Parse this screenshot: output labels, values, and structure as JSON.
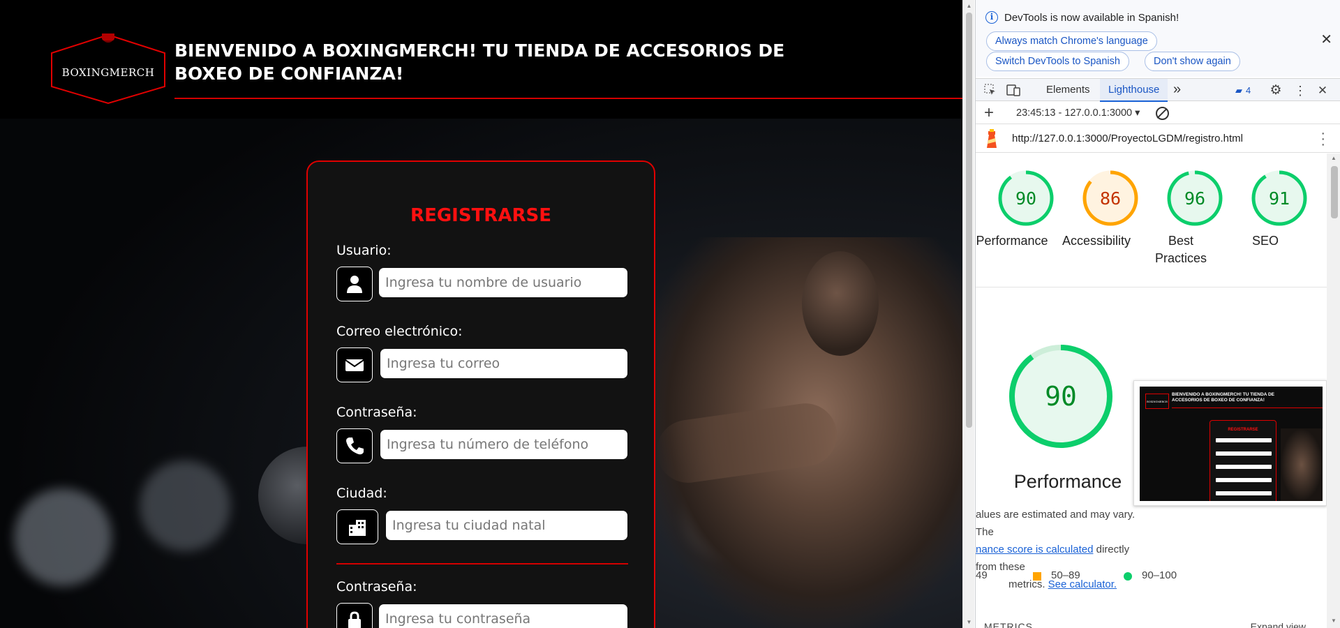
{
  "site": {
    "logo_text": "BOXINGMERCH",
    "title": "BIENVENIDO A BOXINGMERCH! TU TIENDA DE ACCESORIOS DE BOXEO DE CONFIANZA!",
    "form": {
      "heading": "REGISTRARSE",
      "fields": [
        {
          "label": "Usuario:",
          "placeholder": "Ingresa tu nombre de usuario",
          "value": "",
          "icon": "user-icon"
        },
        {
          "label": "Correo electrónico:",
          "placeholder": "Ingresa tu correo",
          "value": "",
          "icon": "envelope-icon"
        },
        {
          "label": "Contraseña:",
          "placeholder": "Ingresa tu número de teléfono",
          "value": "",
          "icon": "phone-icon"
        },
        {
          "label": "Ciudad:",
          "placeholder": "Ingresa tu ciudad natal",
          "value": "",
          "icon": "city-icon"
        },
        {
          "label": "Contraseña:",
          "placeholder": "Ingresa tu contraseña",
          "value": "",
          "icon": "lock-icon"
        }
      ]
    }
  },
  "devtools": {
    "infobar": {
      "message": "DevTools is now available in Spanish!",
      "btn_match": "Always match Chrome's language",
      "btn_switch": "Switch DevTools to Spanish",
      "btn_dont_show": "Don't show again"
    },
    "tabs": {
      "elements": "Elements",
      "lighthouse": "Lighthouse",
      "more": "»",
      "issues_count": "4"
    },
    "session": "23:45:13 - 127.0.0.1:3000 ▾",
    "url": "http://127.0.0.1:3000/ProyectoLGDM/registro.html",
    "scores": [
      {
        "label": "Performance",
        "value": "90",
        "score": 0.9,
        "color": "#0cce6b",
        "bg": "#e7f8ee",
        "text_color": "#008a26"
      },
      {
        "label": "Accessibility",
        "value": "86",
        "score": 0.86,
        "color": "#ffa400",
        "bg": "#fff3e0",
        "text_color": "#c33300"
      },
      {
        "label": "Best Practices",
        "value": "96",
        "score": 0.96,
        "color": "#0cce6b",
        "bg": "#e7f8ee",
        "text_color": "#008a26"
      },
      {
        "label": "SEO",
        "value": "91",
        "score": 0.91,
        "color": "#0cce6b",
        "bg": "#e7f8ee",
        "text_color": "#008a26"
      }
    ],
    "main_score": {
      "label": "Performance",
      "value": "90",
      "score": 0.9
    },
    "thumbnail": {
      "title": "BIENVENIDO A BOXINGMERCH! TU TIENDA DE ACCESORIOS DE BOXEO DE CONFIANZA!",
      "logo": "BOXINGMERCH",
      "heading": "REGISTRARSE"
    },
    "desc": {
      "line1": "alues are estimated and may vary. The",
      "link1": "nance score is calculated",
      "line2": " directly from these",
      "line3": "metrics. ",
      "link2": "See calculator."
    },
    "legend": {
      "fail": "49",
      "average": "50–89",
      "pass": "90–100"
    },
    "metrics_header": "METRICS",
    "expand_view": "Expand view"
  }
}
